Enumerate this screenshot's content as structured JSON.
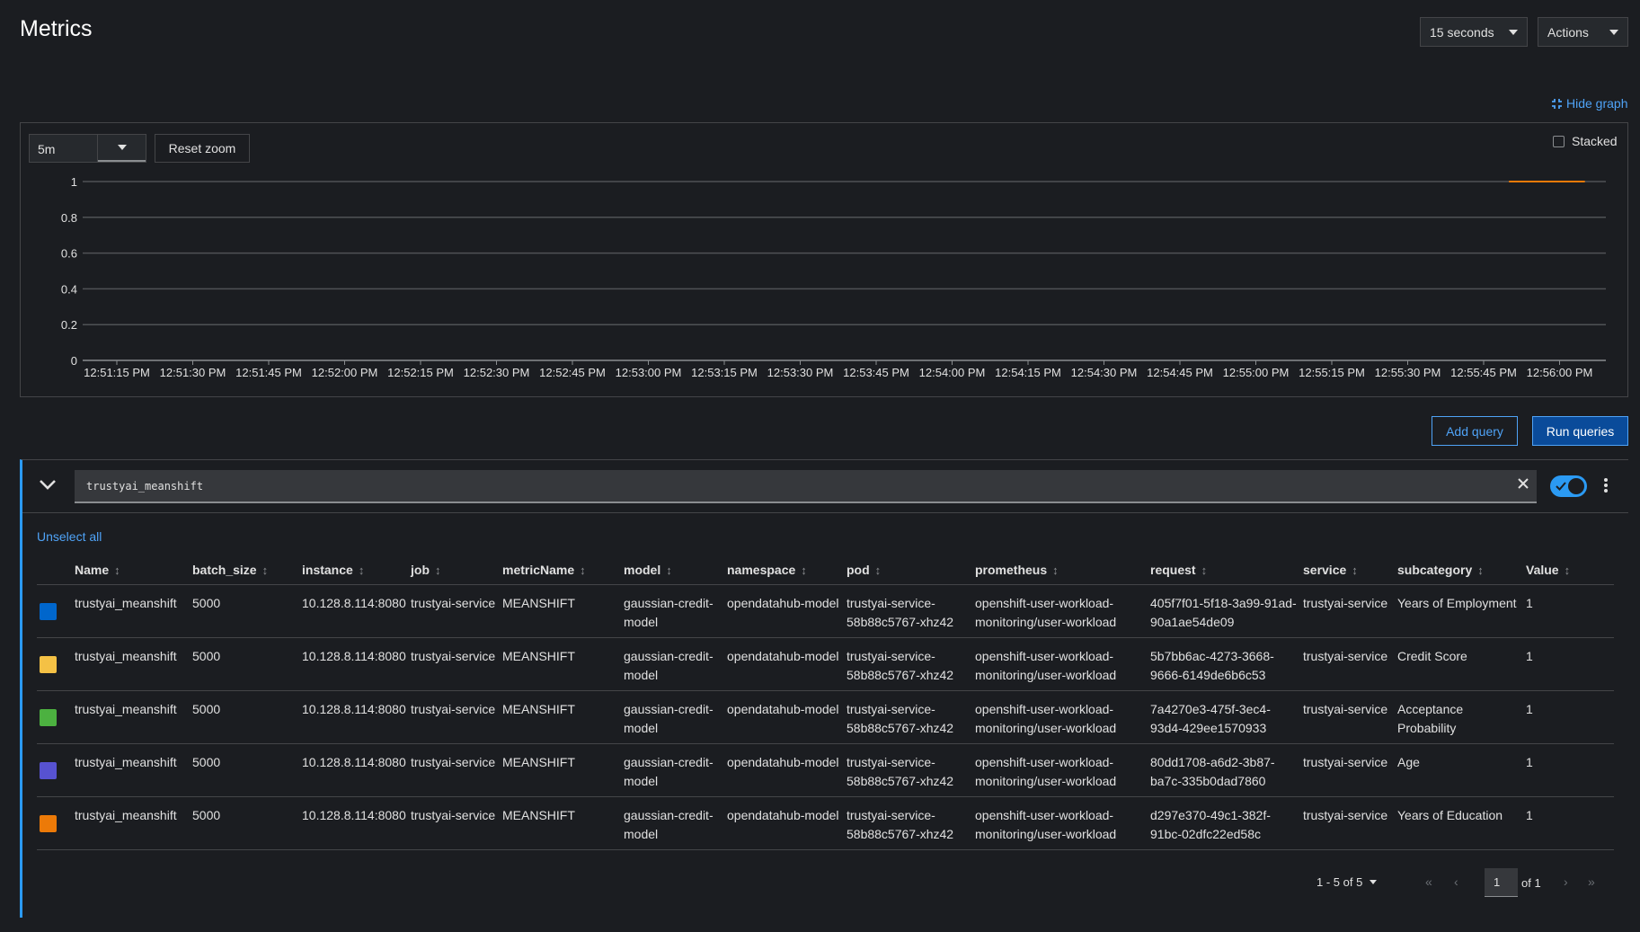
{
  "page": {
    "title": "Metrics"
  },
  "header": {
    "refresh_interval": "15 seconds",
    "actions_label": "Actions"
  },
  "graph": {
    "hide_graph_label": "Hide graph",
    "span": "5m",
    "reset_zoom_label": "Reset zoom",
    "stacked_label": "Stacked",
    "stacked_checked": false
  },
  "chart_data": {
    "type": "line",
    "title": "",
    "xlabel": "",
    "ylabel": "",
    "ylim": [
      0,
      1
    ],
    "yticks": [
      "0",
      "0.2",
      "0.4",
      "0.6",
      "0.8",
      "1"
    ],
    "xticks": [
      "12:51:15 PM",
      "12:51:30 PM",
      "12:51:45 PM",
      "12:52:00 PM",
      "12:52:15 PM",
      "12:52:30 PM",
      "12:52:45 PM",
      "12:53:00 PM",
      "12:53:15 PM",
      "12:53:30 PM",
      "12:53:45 PM",
      "12:54:00 PM",
      "12:54:15 PM",
      "12:54:30 PM",
      "12:54:45 PM",
      "12:55:00 PM",
      "12:55:15 PM",
      "12:55:30 PM",
      "12:55:45 PM",
      "12:56:00 PM"
    ],
    "grid": true,
    "series": [
      {
        "x": [
          "12:55:50 PM",
          "12:56:05 PM"
        ],
        "values": [
          1,
          1
        ],
        "color": "#ec7a08"
      }
    ]
  },
  "query_actions": {
    "add_query_label": "Add query",
    "run_queries_label": "Run queries"
  },
  "query": {
    "expression": "trustyai_meanshift",
    "enabled": true,
    "unselect_all_label": "Unselect all"
  },
  "table": {
    "columns": [
      "Name",
      "batch_size",
      "instance",
      "job",
      "metricName",
      "model",
      "namespace",
      "pod",
      "prometheus",
      "request",
      "service",
      "subcategory",
      "Value"
    ],
    "rows": [
      {
        "color": "#0066cc",
        "cells": [
          "trustyai_meanshift",
          "5000",
          "10.128.8.114:8080",
          "trustyai-service",
          "MEANSHIFT",
          "gaussian-credit-model",
          "opendatahub-model",
          "trustyai-service-58b88c5767-xhz42",
          "openshift-user-workload-monitoring/user-workload",
          "405f7f01-5f18-3a99-91ad-90a1ae54de09",
          "trustyai-service",
          "Years of Employment",
          "1"
        ]
      },
      {
        "color": "#f4c145",
        "cells": [
          "trustyai_meanshift",
          "5000",
          "10.128.8.114:8080",
          "trustyai-service",
          "MEANSHIFT",
          "gaussian-credit-model",
          "opendatahub-model",
          "trustyai-service-58b88c5767-xhz42",
          "openshift-user-workload-monitoring/user-workload",
          "5b7bb6ac-4273-3668-9666-6149de6b6c53",
          "trustyai-service",
          "Credit Score",
          "1"
        ]
      },
      {
        "color": "#4cb140",
        "cells": [
          "trustyai_meanshift",
          "5000",
          "10.128.8.114:8080",
          "trustyai-service",
          "MEANSHIFT",
          "gaussian-credit-model",
          "opendatahub-model",
          "trustyai-service-58b88c5767-xhz42",
          "openshift-user-workload-monitoring/user-workload",
          "7a4270e3-475f-3ec4-93d4-429ee1570933",
          "trustyai-service",
          "Acceptance Probability",
          "1"
        ]
      },
      {
        "color": "#5752d1",
        "cells": [
          "trustyai_meanshift",
          "5000",
          "10.128.8.114:8080",
          "trustyai-service",
          "MEANSHIFT",
          "gaussian-credit-model",
          "opendatahub-model",
          "trustyai-service-58b88c5767-xhz42",
          "openshift-user-workload-monitoring/user-workload",
          "80dd1708-a6d2-3b87-ba7c-335b0dad7860",
          "trustyai-service",
          "Age",
          "1"
        ]
      },
      {
        "color": "#ec7a08",
        "cells": [
          "trustyai_meanshift",
          "5000",
          "10.128.8.114:8080",
          "trustyai-service",
          "MEANSHIFT",
          "gaussian-credit-model",
          "opendatahub-model",
          "trustyai-service-58b88c5767-xhz42",
          "openshift-user-workload-monitoring/user-workload",
          "d297e370-49c1-382f-91bc-02dfc22ed58c",
          "trustyai-service",
          "Years of Education",
          "1"
        ]
      }
    ]
  },
  "pagination": {
    "range": "1 - 5 of 5",
    "page": "1",
    "of_label": "of 1"
  }
}
